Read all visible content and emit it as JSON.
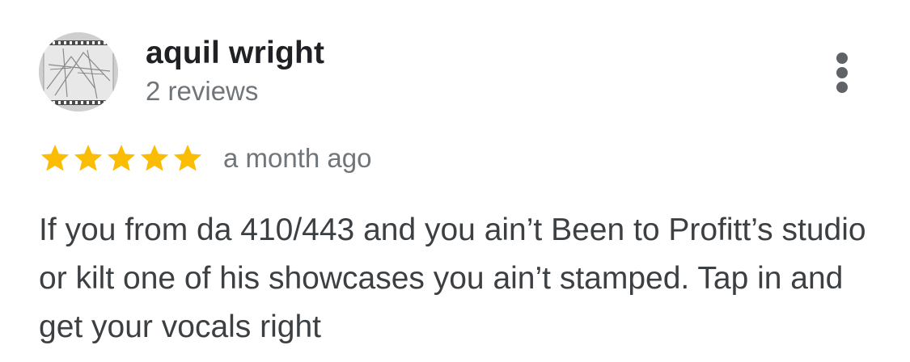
{
  "review": {
    "author": {
      "name": "aquil wright",
      "review_count": "2 reviews",
      "avatar_icon": "profile-photo-icon"
    },
    "rating": {
      "stars": 5,
      "max_stars": 5,
      "star_color": "#fbbc04",
      "icon": "star-icon"
    },
    "date": "a month ago",
    "text": "If you from da 410/443 and you ain’t Been to Profitt’s studio or kilt one of his showcases you ain’t stamped. Tap in and get your vocals right",
    "more_options_icon": "more-vert-icon"
  },
  "colors": {
    "name": "#202124",
    "secondary": "#70757a",
    "body": "#3c4043",
    "icon": "#5f6368"
  }
}
